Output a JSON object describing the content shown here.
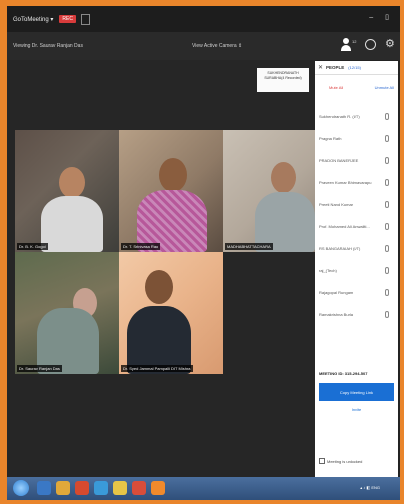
{
  "titlebar": {
    "app_name": "GoToMeeting ▾",
    "rec_badge": "REC",
    "window_controls": "– ▯"
  },
  "infobar": {
    "viewing_text": "Viewing Dr. Saurav Ranjan Das",
    "view_mode": "View Active Camera ⇕",
    "people_count": "12"
  },
  "notification": {
    "line1": "SUKHENDRANATH",
    "line2": "SURABHA(4 Recorded)"
  },
  "videos": [
    {
      "label": "Dr. B. K. Gogoi"
    },
    {
      "label": "Dr. T. Srinivasa Rao"
    },
    {
      "label": "MADHABHATTACHARA"
    },
    {
      "label": "Dr. Saurav Ranjan Das"
    },
    {
      "label": "Dr. Syed Jammal Pampalli DIT Mishra"
    }
  ],
  "panel": {
    "close_icon": "✕",
    "title": "PEOPLE",
    "subtitle": "(12/15)",
    "mute_all": "Mute All",
    "unmute_all": "Unmute All",
    "participants": [
      "Sukhendranath R. (I/T)",
      "Pragna Rath",
      "PRADON BANERJEE",
      "Praveen Kumar Bhimavarapu",
      "Preeti Nand Kumar",
      "Prof. Mohamed Ali Anwaliti...",
      "RS BANGARAIAH (I/T)",
      "raj_(Tech)",
      "Rajagopal Rungam",
      "Ramakrishna Burla"
    ],
    "meeting_id": "MEETING ID: 315-294-507",
    "copy_link": "Copy Meeting Link",
    "invite": "Invite",
    "unlock": "Meeting is unlocked"
  },
  "taskbar": {
    "tray_text": "▴ ♪ ◧ ENG"
  }
}
